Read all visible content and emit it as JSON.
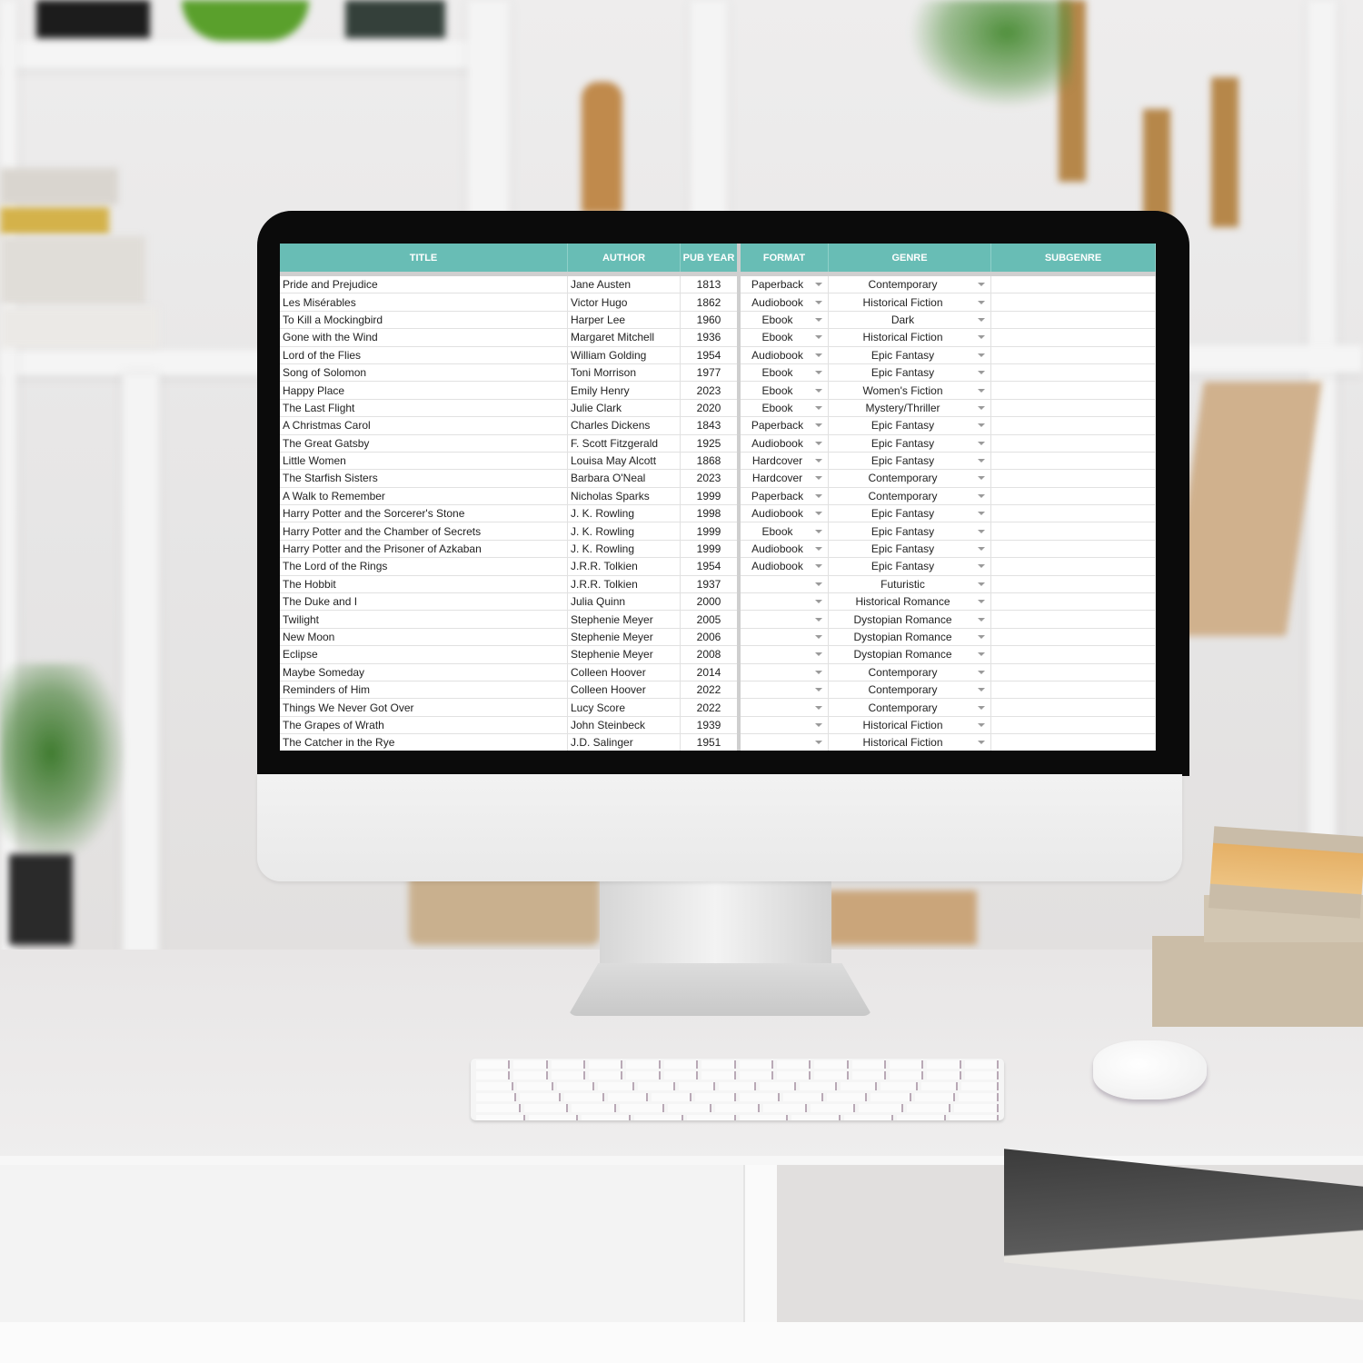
{
  "spreadsheet": {
    "columns": [
      "TITLE",
      "AUTHOR",
      "PUB YEAR",
      "FORMAT",
      "GENRE",
      "SUBGENRE"
    ],
    "rows": [
      {
        "title": "Pride and Prejudice",
        "author": "Jane Austen",
        "year": "1813",
        "format": "Paperback",
        "genre": "Contemporary",
        "subgenre": ""
      },
      {
        "title": "Les Misérables",
        "author": "Victor Hugo",
        "year": "1862",
        "format": "Audiobook",
        "genre": "Historical Fiction",
        "subgenre": ""
      },
      {
        "title": "To Kill a Mockingbird",
        "author": "Harper Lee",
        "year": "1960",
        "format": "Ebook",
        "genre": "Dark",
        "subgenre": ""
      },
      {
        "title": "Gone with the Wind",
        "author": "Margaret Mitchell",
        "year": "1936",
        "format": "Ebook",
        "genre": "Historical Fiction",
        "subgenre": ""
      },
      {
        "title": "Lord of the Flies",
        "author": "William Golding",
        "year": "1954",
        "format": "Audiobook",
        "genre": "Epic Fantasy",
        "subgenre": ""
      },
      {
        "title": "Song of Solomon",
        "author": "Toni Morrison",
        "year": "1977",
        "format": "Ebook",
        "genre": "Epic Fantasy",
        "subgenre": ""
      },
      {
        "title": "Happy Place",
        "author": "Emily Henry",
        "year": "2023",
        "format": "Ebook",
        "genre": "Women's Fiction",
        "subgenre": ""
      },
      {
        "title": "The Last Flight",
        "author": "Julie Clark",
        "year": "2020",
        "format": "Ebook",
        "genre": "Mystery/Thriller",
        "subgenre": ""
      },
      {
        "title": "A Christmas Carol",
        "author": "Charles Dickens",
        "year": "1843",
        "format": "Paperback",
        "genre": "Epic Fantasy",
        "subgenre": ""
      },
      {
        "title": "The Great Gatsby",
        "author": "F. Scott Fitzgerald",
        "year": "1925",
        "format": "Audiobook",
        "genre": "Epic Fantasy",
        "subgenre": ""
      },
      {
        "title": "Little Women",
        "author": "Louisa May Alcott",
        "year": "1868",
        "format": "Hardcover",
        "genre": "Epic Fantasy",
        "subgenre": ""
      },
      {
        "title": "The Starfish Sisters",
        "author": "Barbara O'Neal",
        "year": "2023",
        "format": "Hardcover",
        "genre": "Contemporary",
        "subgenre": ""
      },
      {
        "title": "A Walk to Remember",
        "author": "Nicholas Sparks",
        "year": "1999",
        "format": "Paperback",
        "genre": "Contemporary",
        "subgenre": ""
      },
      {
        "title": "Harry Potter and the Sorcerer's Stone",
        "author": "J. K. Rowling",
        "year": "1998",
        "format": "Audiobook",
        "genre": "Epic Fantasy",
        "subgenre": ""
      },
      {
        "title": "Harry Potter and the Chamber of Secrets",
        "author": "J. K. Rowling",
        "year": "1999",
        "format": "Ebook",
        "genre": "Epic Fantasy",
        "subgenre": ""
      },
      {
        "title": "Harry Potter and the Prisoner of Azkaban",
        "author": "J. K. Rowling",
        "year": "1999",
        "format": "Audiobook",
        "genre": "Epic Fantasy",
        "subgenre": ""
      },
      {
        "title": "The Lord of the Rings",
        "author": "J.R.R. Tolkien",
        "year": "1954",
        "format": "Audiobook",
        "genre": "Epic Fantasy",
        "subgenre": ""
      },
      {
        "title": "The Hobbit",
        "author": "J.R.R. Tolkien",
        "year": "1937",
        "format": "",
        "genre": "Futuristic",
        "subgenre": ""
      },
      {
        "title": "The Duke and I",
        "author": "Julia Quinn",
        "year": "2000",
        "format": "",
        "genre": "Historical Romance",
        "subgenre": ""
      },
      {
        "title": "Twilight",
        "author": "Stephenie Meyer",
        "year": "2005",
        "format": "",
        "genre": "Dystopian Romance",
        "subgenre": ""
      },
      {
        "title": "New Moon",
        "author": "Stephenie Meyer",
        "year": "2006",
        "format": "",
        "genre": "Dystopian Romance",
        "subgenre": ""
      },
      {
        "title": "Eclipse",
        "author": "Stephenie Meyer",
        "year": "2008",
        "format": "",
        "genre": "Dystopian Romance",
        "subgenre": ""
      },
      {
        "title": "Maybe Someday",
        "author": "Colleen Hoover",
        "year": "2014",
        "format": "",
        "genre": "Contemporary",
        "subgenre": ""
      },
      {
        "title": "Reminders of Him",
        "author": "Colleen Hoover",
        "year": "2022",
        "format": "",
        "genre": "Contemporary",
        "subgenre": ""
      },
      {
        "title": "Things We Never Got Over",
        "author": "Lucy Score",
        "year": "2022",
        "format": "",
        "genre": "Contemporary",
        "subgenre": ""
      },
      {
        "title": "The Grapes of Wrath",
        "author": " John Steinbeck",
        "year": "1939",
        "format": "",
        "genre": "Historical Fiction",
        "subgenre": ""
      },
      {
        "title": "The Catcher in the Rye",
        "author": "J.D. Salinger",
        "year": "1951",
        "format": "",
        "genre": "Historical Fiction",
        "subgenre": ""
      }
    ]
  },
  "colors": {
    "header_bg": "#68bdb5",
    "header_text": "#ffffff",
    "bezel": "#0b0b0b"
  },
  "icons": {
    "dropdown": "caret-down-icon"
  }
}
